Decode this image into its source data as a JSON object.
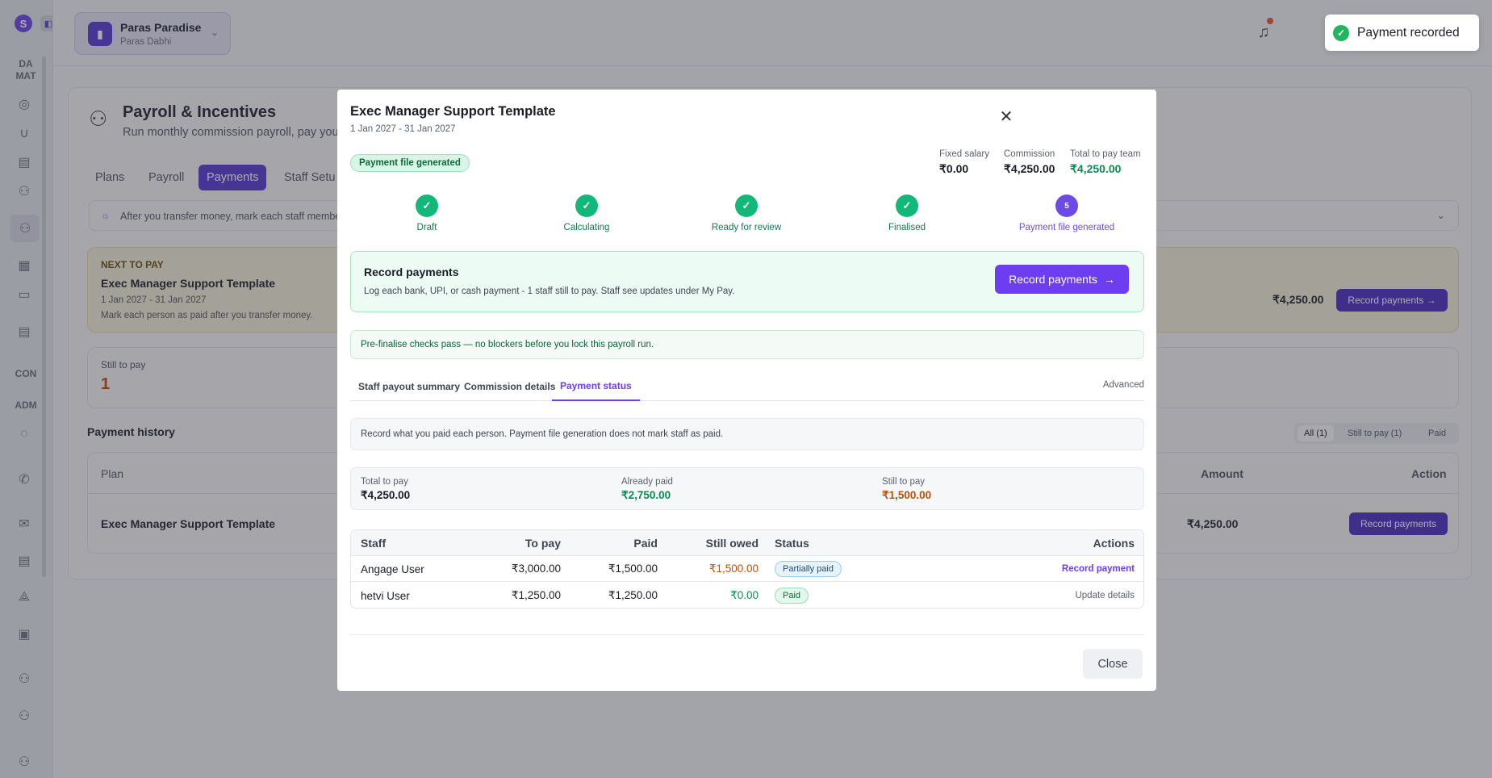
{
  "sidebar": {
    "logo": "S",
    "sections": [
      "DA\nMAT",
      "CON",
      "ADM"
    ]
  },
  "org": {
    "name": "Paras Paradise",
    "user": "Paras Dabhi"
  },
  "page": {
    "title": "Payroll & Incentives",
    "subtitle": "Run monthly commission payroll, pay your",
    "tabs": [
      "Plans",
      "Payroll",
      "Payments",
      "Staff Setu"
    ],
    "active_tab": "Payments",
    "info": "After you transfer money, mark each staff member",
    "next_to_pay": {
      "label": "NEXT TO PAY",
      "plan": "Exec Manager Support Template",
      "dates": "1 Jan 2027 - 31 Jan 2027",
      "hint": "Mark each person as paid after you transfer money.",
      "amount": "₹4,250.00",
      "button": "Record payments"
    },
    "still_to_pay": {
      "label": "Still to pay",
      "value": "1"
    },
    "history": {
      "title": "Payment history",
      "filters": [
        "All (1)",
        "Still to pay (1)",
        "Paid"
      ],
      "columns": {
        "plan": "Plan",
        "amount": "Amount",
        "action": "Action"
      },
      "row": {
        "plan": "Exec Manager Support Template",
        "amount": "₹4,250.00",
        "action": "Record payments"
      }
    }
  },
  "modal": {
    "title": "Exec Manager Support Template",
    "dates": "1 Jan 2027 - 31 Jan 2027",
    "badge": "Payment file generated",
    "summary": [
      {
        "label": "Fixed salary",
        "value": "₹0.00"
      },
      {
        "label": "Commission",
        "value": "₹4,250.00"
      },
      {
        "label": "Total to pay team",
        "value": "₹4,250.00"
      }
    ],
    "steps": [
      {
        "label": "Draft",
        "state": "done"
      },
      {
        "label": "Calculating",
        "state": "done"
      },
      {
        "label": "Ready for review",
        "state": "done"
      },
      {
        "label": "Finalised",
        "state": "done"
      },
      {
        "label": "Payment file generated",
        "state": "current",
        "number": "5"
      }
    ],
    "record": {
      "title": "Record payments",
      "desc": "Log each bank, UPI, or cash payment - 1 staff still to pay. Staff see updates under My Pay.",
      "button": "Record payments"
    },
    "checks": "Pre-finalise checks pass — no blockers before you lock this payroll run.",
    "tabs": [
      "Staff payout summary",
      "Commission details",
      "Payment status"
    ],
    "active_tab": "Payment status",
    "advanced": "Advanced",
    "note": "Record what you paid each person. Payment file generation does not mark staff as paid.",
    "totals": [
      {
        "label": "Total to pay",
        "value": "₹4,250.00"
      },
      {
        "label": "Already paid",
        "value": "₹2,750.00"
      },
      {
        "label": "Still to pay",
        "value": "₹1,500.00"
      }
    ],
    "table": {
      "columns": [
        "Staff",
        "To pay",
        "Paid",
        "Still owed",
        "Status",
        "Actions"
      ],
      "rows": [
        {
          "staff": "Angage User",
          "to_pay": "₹3,000.00",
          "paid": "₹1,500.00",
          "owed": "₹1,500.00",
          "status": "Partially paid",
          "action": "Record payment"
        },
        {
          "staff": "hetvi User",
          "to_pay": "₹1,250.00",
          "paid": "₹1,250.00",
          "owed": "₹0.00",
          "status": "Paid",
          "action": "Update details"
        }
      ]
    },
    "close": "Close"
  },
  "toast": {
    "text": "Payment recorded"
  },
  "colors": {
    "accent": "#6d3ef0",
    "success": "#0b8a55",
    "warning": "#b8520c"
  }
}
